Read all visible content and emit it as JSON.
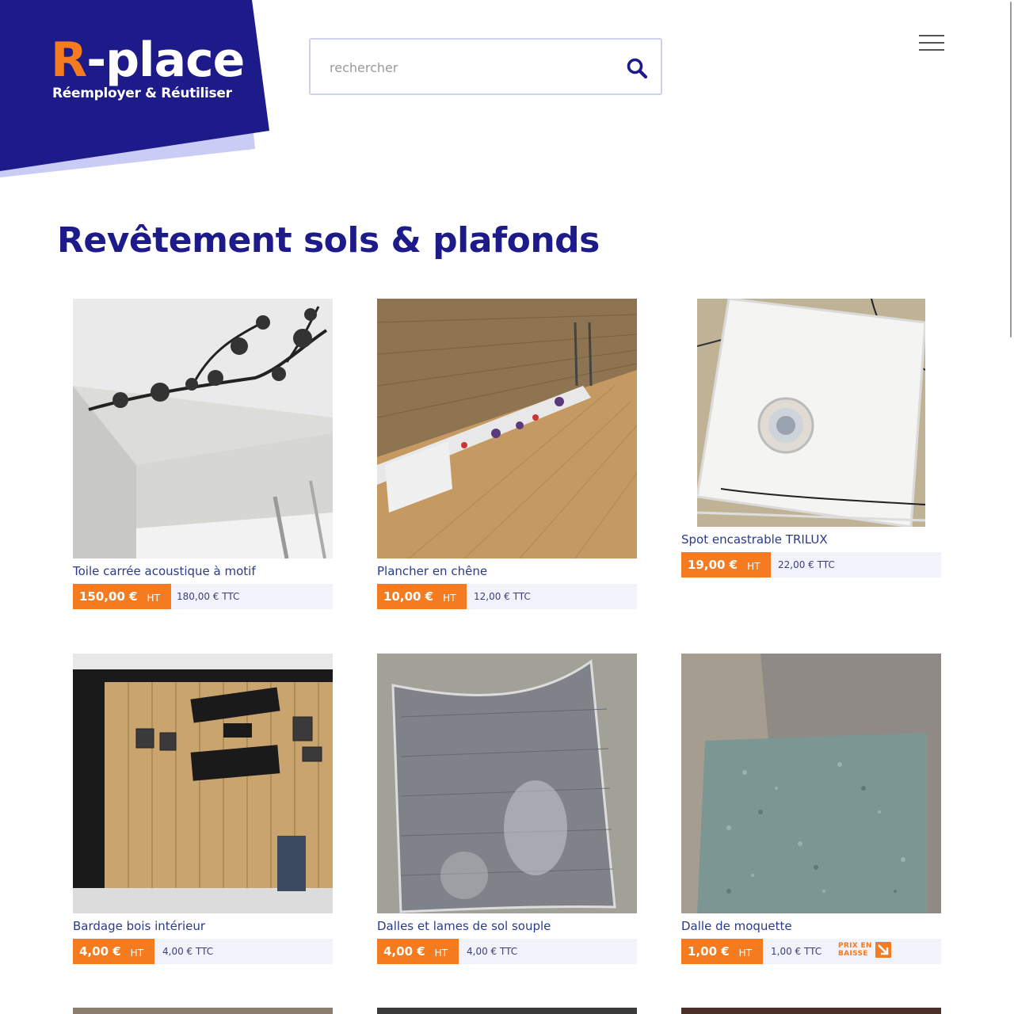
{
  "brand": {
    "logo_r": "R",
    "logo_rest": "-place",
    "tagline": "Réemployer & Réutiliser",
    "accent_color": "#f47b20",
    "primary_color": "#1d1a8a"
  },
  "search": {
    "placeholder": "rechercher",
    "icon": "search-icon"
  },
  "menu": {
    "icon": "hamburger-menu-icon"
  },
  "page_title": "Revêtement sols & plafonds",
  "products": [
    {
      "name": "Toile carrée acoustique à motif",
      "price_ht": "150,00 €",
      "ht_label": "HT",
      "price_ttc": "180,00 € TTC",
      "price_drop": false
    },
    {
      "name": "Plancher en chêne",
      "price_ht": "10,00 €",
      "ht_label": "HT",
      "price_ttc": "12,00 € TTC",
      "price_drop": false
    },
    {
      "name": "Spot encastrable TRILUX",
      "price_ht": "19,00 €",
      "ht_label": "HT",
      "price_ttc": "22,00 € TTC",
      "price_drop": false
    },
    {
      "name": "Bardage bois intérieur",
      "price_ht": "4,00 €",
      "ht_label": "HT",
      "price_ttc": "4,00 € TTC",
      "price_drop": false
    },
    {
      "name": "Dalles et lames de sol souple",
      "price_ht": "4,00 €",
      "ht_label": "HT",
      "price_ttc": "4,00 € TTC",
      "price_drop": false
    },
    {
      "name": "Dalle de moquette",
      "price_ht": "1,00 €",
      "ht_label": "HT",
      "price_ttc": "1,00 € TTC",
      "price_drop": true,
      "badge_line1": "PRIX EN",
      "badge_line2": "BAISSE"
    }
  ]
}
